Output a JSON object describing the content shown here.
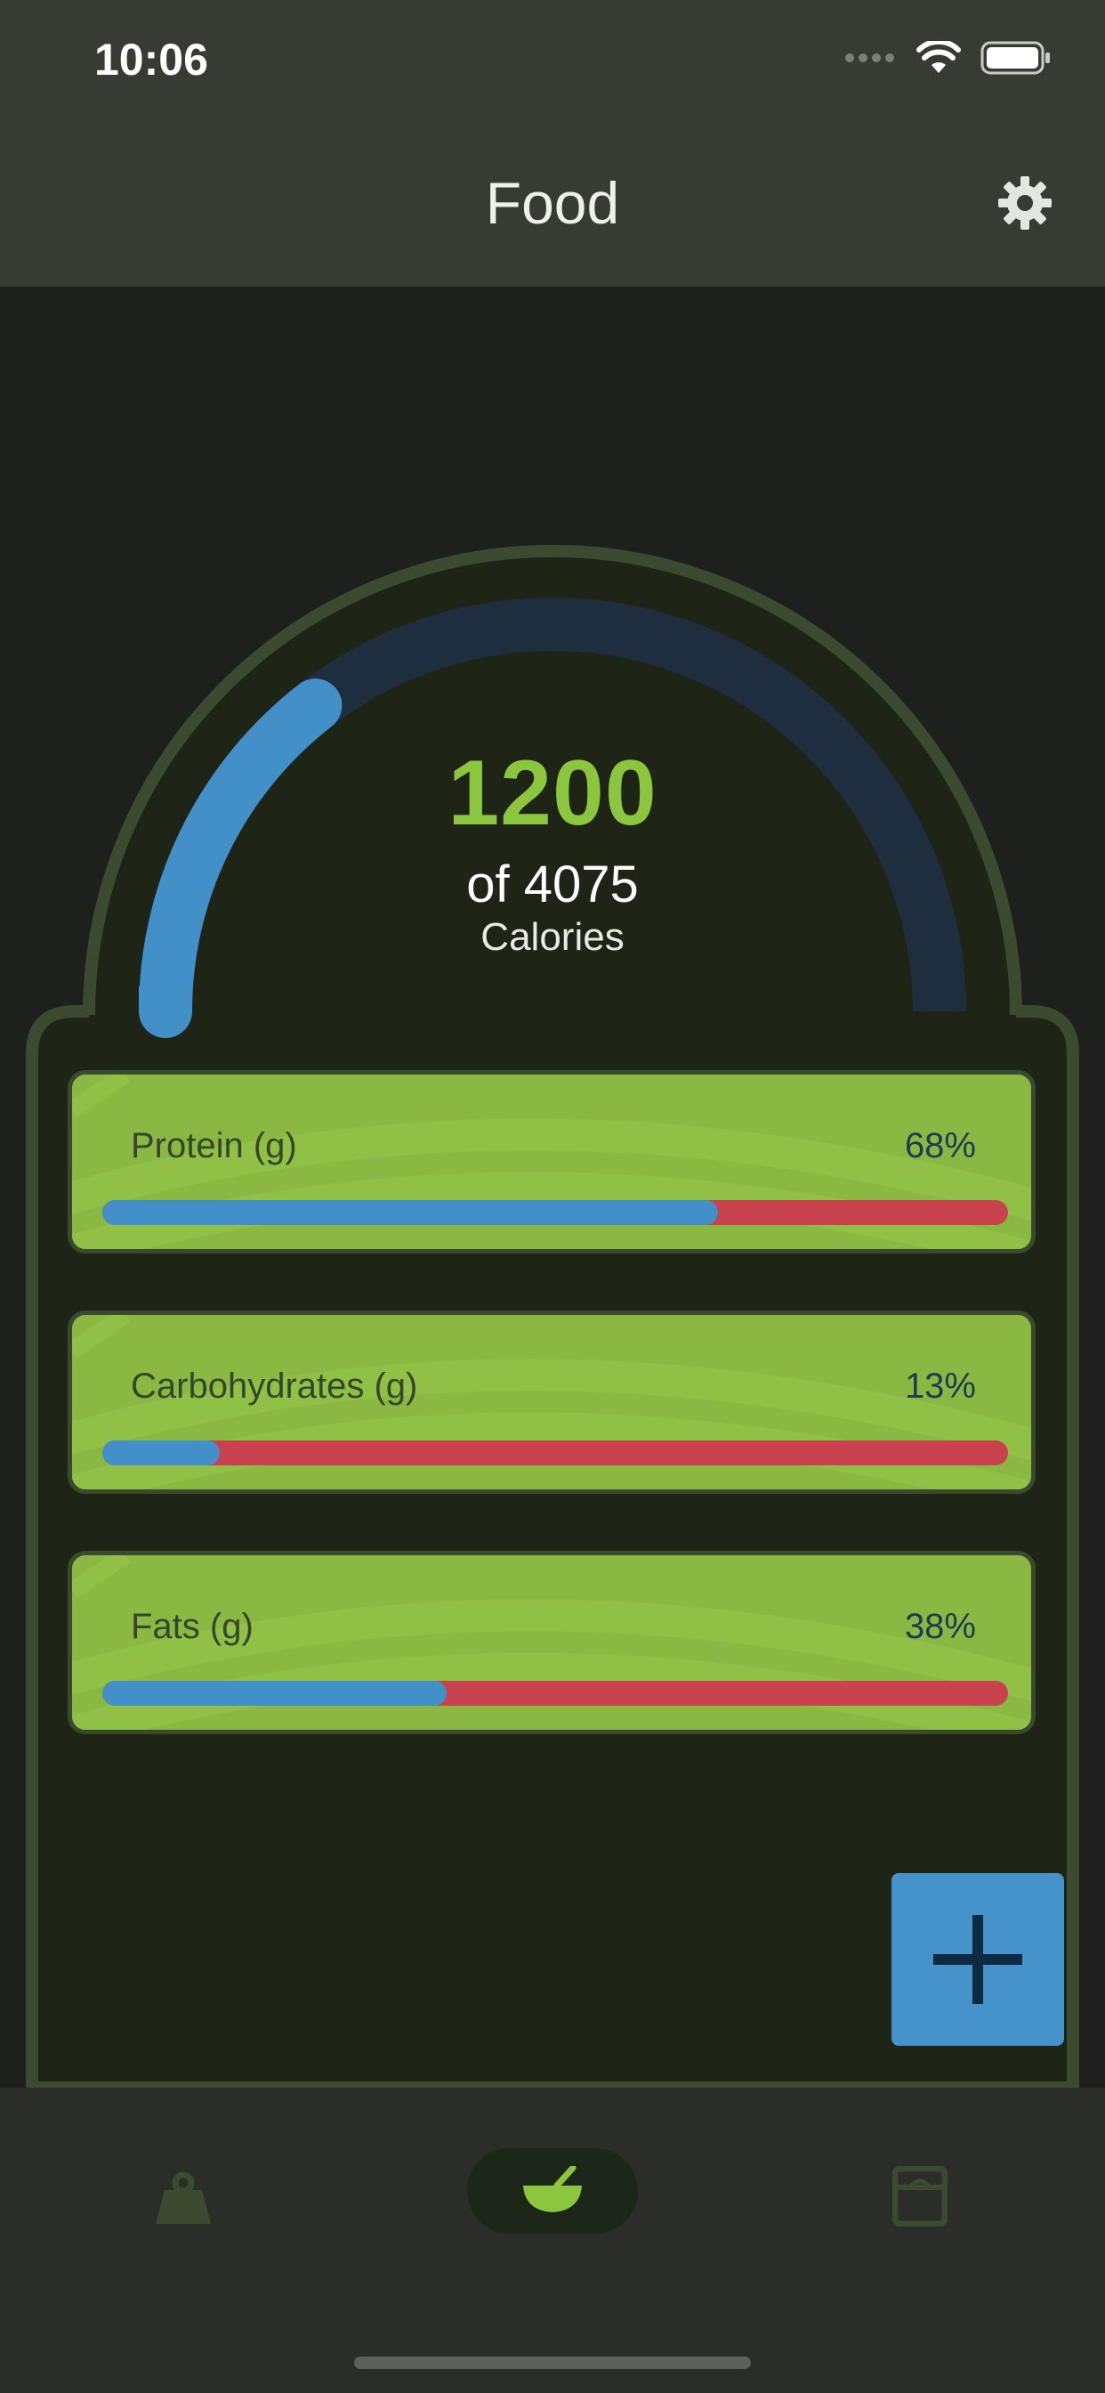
{
  "status_bar": {
    "time": "10:06"
  },
  "header": {
    "title": "Food"
  },
  "calories": {
    "consumed": "1200",
    "of_text": "of 4075",
    "unit": "Calories",
    "progress": 0.29
  },
  "macros": [
    {
      "label": "Protein (g)",
      "percent_text": "68%",
      "progress": 0.68
    },
    {
      "label": "Carbohydrates (g)",
      "percent_text": "13%",
      "progress": 0.13
    },
    {
      "label": "Fats (g)",
      "percent_text": "38%",
      "progress": 0.38
    }
  ],
  "colors": {
    "accent_green": "#8cc63e",
    "progress_blue": "#4390c8",
    "remaining_red": "#c8434e",
    "gauge_track": "#1f2e3e"
  },
  "icons": {
    "settings": "gear-icon",
    "add": "plus-icon",
    "nav_weight": "weight-icon",
    "nav_food": "bowl-icon",
    "nav_scale": "scale-icon"
  }
}
